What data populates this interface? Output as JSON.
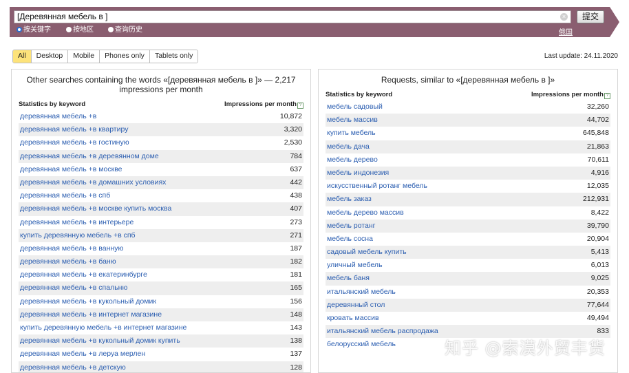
{
  "search": {
    "query": "[Деревянная мебель в ]",
    "submit_label": "提交",
    "radio_options": [
      {
        "label": "按关键字",
        "selected": true
      },
      {
        "label": "按地区",
        "selected": false
      },
      {
        "label": "查询历史",
        "selected": false
      }
    ],
    "language_link": "俄国"
  },
  "filters": {
    "tabs": [
      {
        "label": "All",
        "active": true
      },
      {
        "label": "Desktop",
        "active": false
      },
      {
        "label": "Mobile",
        "active": false
      },
      {
        "label": "Phones only",
        "active": false
      },
      {
        "label": "Tablets only",
        "active": false
      }
    ],
    "last_update": "Last update: 24.11.2020"
  },
  "left_panel": {
    "title": "Other searches containing the words «[деревянная мебель в ]» — 2,217 impressions per month",
    "col_keyword": "Statistics by keyword",
    "col_impressions": "Impressions per month",
    "rows": [
      {
        "kw": "деревянная мебель +в",
        "n": "10,872"
      },
      {
        "kw": "деревянная мебель +в квартиру",
        "n": "3,320"
      },
      {
        "kw": "деревянная мебель +в гостиную",
        "n": "2,530"
      },
      {
        "kw": "деревянная мебель +в деревянном доме",
        "n": "784"
      },
      {
        "kw": "деревянная мебель +в москве",
        "n": "637"
      },
      {
        "kw": "деревянная мебель +в домашних условиях",
        "n": "442"
      },
      {
        "kw": "деревянная мебель +в спб",
        "n": "438"
      },
      {
        "kw": "деревянная мебель +в москве купить москва",
        "n": "407"
      },
      {
        "kw": "деревянная мебель +в интерьере",
        "n": "273"
      },
      {
        "kw": "купить деревянную мебель +в спб",
        "n": "271"
      },
      {
        "kw": "деревянная мебель +в ванную",
        "n": "187"
      },
      {
        "kw": "деревянная мебель +в баню",
        "n": "182"
      },
      {
        "kw": "деревянная мебель +в екатеринбурге",
        "n": "181"
      },
      {
        "kw": "деревянная мебель +в спальню",
        "n": "165"
      },
      {
        "kw": "деревянная мебель +в кукольный домик",
        "n": "156"
      },
      {
        "kw": "деревянная мебель +в интернет магазине",
        "n": "148"
      },
      {
        "kw": "купить деревянную мебель +в интернет магазине",
        "n": "143"
      },
      {
        "kw": "деревянная мебель +в кукольный домик купить",
        "n": "138"
      },
      {
        "kw": "деревянная мебель +в леруа мерлен",
        "n": "137"
      },
      {
        "kw": "деревянная мебель +в детскую",
        "n": "128"
      }
    ]
  },
  "right_panel": {
    "title": "Requests, similar to «[деревянная мебель в ]»",
    "col_keyword": "Statistics by keyword",
    "col_impressions": "Impressions per month",
    "rows": [
      {
        "kw": "мебель садовый",
        "n": "32,260"
      },
      {
        "kw": "мебель массив",
        "n": "44,702"
      },
      {
        "kw": "купить мебель",
        "n": "645,848"
      },
      {
        "kw": "мебель дача",
        "n": "21,863"
      },
      {
        "kw": "мебель дерево",
        "n": "70,611"
      },
      {
        "kw": "мебель индонезия",
        "n": "4,916"
      },
      {
        "kw": "искусственный ротанг мебель",
        "n": "12,035"
      },
      {
        "kw": "мебель заказ",
        "n": "212,931"
      },
      {
        "kw": "мебель дерево массив",
        "n": "8,422"
      },
      {
        "kw": "мебель ротанг",
        "n": "39,790"
      },
      {
        "kw": "мебель сосна",
        "n": "20,904"
      },
      {
        "kw": "садовый мебель купить",
        "n": "5,413"
      },
      {
        "kw": "уличный мебель",
        "n": "6,013"
      },
      {
        "kw": "мебель баня",
        "n": "9,025"
      },
      {
        "kw": "итальянский мебель",
        "n": "20,353"
      },
      {
        "kw": "деревянный стол",
        "n": "77,644"
      },
      {
        "kw": "кровать массив",
        "n": "49,494"
      },
      {
        "kw": "итальянский мебель распродажа",
        "n": "833"
      },
      {
        "kw": "белорусский мебель",
        "n": ""
      }
    ]
  },
  "watermark": "知乎 @索漠外贸丰货"
}
